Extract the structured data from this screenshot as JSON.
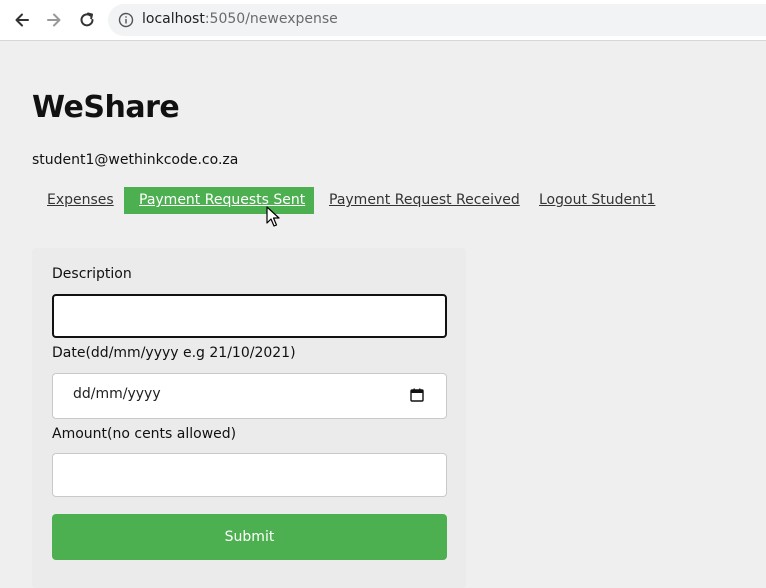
{
  "browser": {
    "url_host": "localhost",
    "url_path": ":5050/newexpense"
  },
  "app": {
    "title": "WeShare",
    "user_email": "student1@wethinkcode.co.za"
  },
  "nav": {
    "items": [
      {
        "label": "Expenses",
        "active": false
      },
      {
        "label": "Payment Requests Sent",
        "active": true
      },
      {
        "label": "Payment Request Received",
        "active": false
      },
      {
        "label": "Logout Student1",
        "active": false
      }
    ]
  },
  "form": {
    "description_label": "Description",
    "description_value": "",
    "date_label": "Date(dd/mm/yyyy e.g 21/10/2021)",
    "date_placeholder": "dd/mm/yyyy",
    "amount_label": "Amount(no cents allowed)",
    "amount_value": "",
    "submit_label": "Submit"
  },
  "colors": {
    "accent": "#4caf50",
    "background": "#efefef"
  },
  "icons": [
    "back-arrow-icon",
    "forward-arrow-icon",
    "reload-icon",
    "info-icon",
    "calendar-icon",
    "mouse-cursor-icon"
  ]
}
